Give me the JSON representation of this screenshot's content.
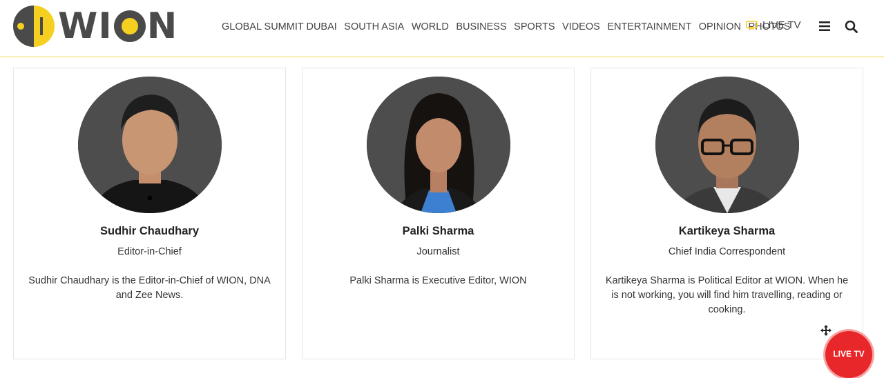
{
  "header": {
    "logo_text_w": "W",
    "logo_text_i": "I",
    "logo_text_n": "N",
    "nav": [
      "GLOBAL SUMMIT DUBAI",
      "SOUTH ASIA",
      "WORLD",
      "BUSINESS",
      "SPORTS",
      "VIDEOS",
      "ENTERTAINMENT",
      "OPINION",
      "PHOTOS"
    ],
    "live_tv_label": "LIVE TV",
    "accent_color": "#f5d020"
  },
  "cards": [
    {
      "name": "Sudhir Chaudhary",
      "role": "Editor-in-Chief",
      "bio": "Sudhir Chaudhary is the Editor-in-Chief of WION, DNA and Zee News."
    },
    {
      "name": "Palki Sharma",
      "role": "Journalist",
      "bio": "Palki Sharma is Executive Editor, WION"
    },
    {
      "name": "Kartikeya Sharma",
      "role": "Chief India Correspondent",
      "bio": "Kartikeya Sharma is Political Editor at WION. When he is not working, you will find him travelling, reading or cooking."
    }
  ],
  "floating": {
    "live_tv_label": "LIVE TV",
    "color": "#e8272a"
  },
  "icons": {
    "tv": "tv-icon",
    "menu": "hamburger-menu-icon",
    "search": "search-icon",
    "move": "move-icon"
  }
}
